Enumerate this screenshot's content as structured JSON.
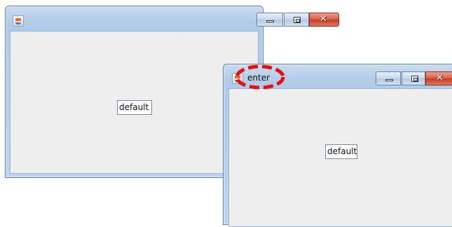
{
  "windows": [
    {
      "title": "",
      "textfield_value": "default",
      "controls": {
        "minimize": "minimize",
        "maximize": "maximize",
        "close": "close"
      }
    },
    {
      "title": "enter",
      "textfield_value": "default",
      "controls": {
        "minimize": "minimize",
        "maximize": "maximize",
        "close": "close"
      }
    }
  ],
  "annotation": {
    "shape": "dashed-ellipse",
    "color": "#e8100c"
  },
  "colors": {
    "titlebar": "#b6cde8",
    "close_button": "#c43b22",
    "content_bg": "#eeeeee"
  },
  "icons": [
    "java-app-icon",
    "minimize-icon",
    "maximize-icon",
    "close-icon"
  ]
}
